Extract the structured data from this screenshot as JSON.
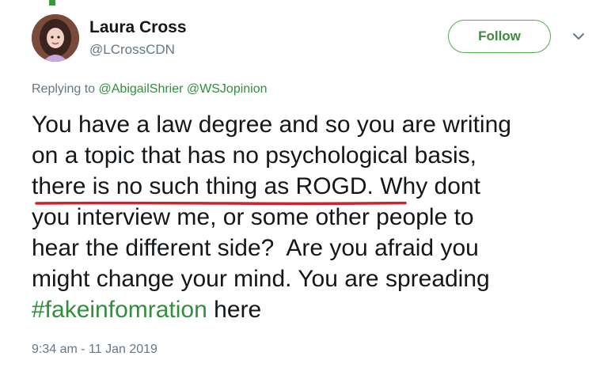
{
  "user": {
    "display_name": "Laura Cross",
    "handle": "@LCrossCDN"
  },
  "follow_button": {
    "label": "Follow"
  },
  "reply": {
    "prefix": "Replying to ",
    "mentions": [
      "@AbigailShrier",
      "@WSJopinion"
    ]
  },
  "tweet": {
    "lines": [
      "You have a law degree and so you are writing",
      "on a topic that has no psychological basis,",
      "there is no such thing as ROGD. Why dont",
      "you interview me, or some other people to",
      "hear the different side?  Are you afraid you",
      "might change your mind. You are spreading"
    ],
    "hashtag": "#fakeinfomration",
    "after_hashtag": " here"
  },
  "timestamp": "9:34 am - 11 Jan 2019",
  "colors": {
    "accent_green": "#2f8f3a",
    "underline_red": "#d3202a",
    "secondary_text": "#657786"
  }
}
